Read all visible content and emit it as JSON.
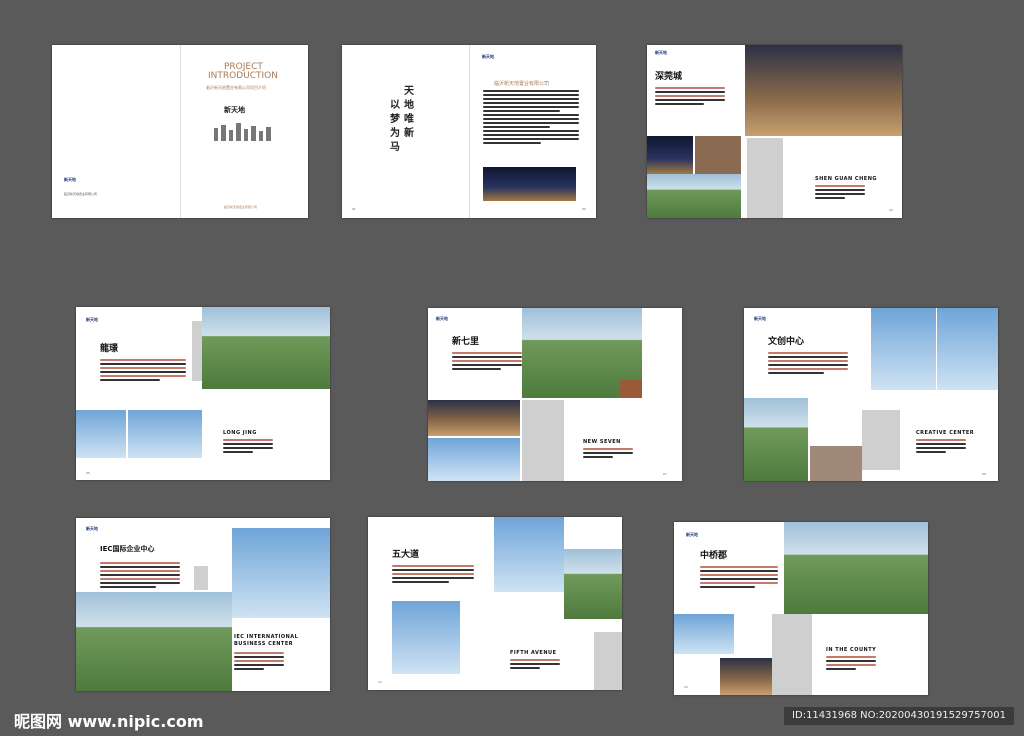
{
  "watermark": {
    "site": "昵图网 www.nipic.com",
    "id": "ID:11431968 NO:20200430191529757001"
  },
  "cover": {
    "title_line1": "PROJECT",
    "title_line2": "INTRODUCTION",
    "subtitle": "临沂新天地置业有限公司项目介绍",
    "brand": "新天地",
    "company": "临沂新天地置业有限公司"
  },
  "intro": {
    "slogan_col1": "天地唯新",
    "slogan_col2": "以梦为马",
    "heading": "临沂新天地置业有限公司",
    "page_left": "01",
    "page_right": "02"
  },
  "projects": [
    {
      "cn": "深莞城",
      "en": "SHEN GUAN CHENG",
      "page": "03"
    },
    {
      "cn": "龍璟",
      "en": "LONG JING",
      "page": "05"
    },
    {
      "cn": "新七里",
      "en": "NEW SEVEN",
      "page": "07"
    },
    {
      "cn": "文创中心",
      "en": "CREATIVE CENTER",
      "page": "09"
    },
    {
      "cn": "IEC国际企业中心",
      "en": "IEC INTERNATIONAL BUSINESS CENTER",
      "page": "11"
    },
    {
      "cn": "五大道",
      "en": "FIFTH AVENUE",
      "page": "13"
    },
    {
      "cn": "中桥郡",
      "en": "IN THE COUNTY",
      "page": "15"
    }
  ],
  "colors": {
    "background": "#5a5a5a",
    "accent": "#c47a6a",
    "brand": "#223a7a"
  }
}
